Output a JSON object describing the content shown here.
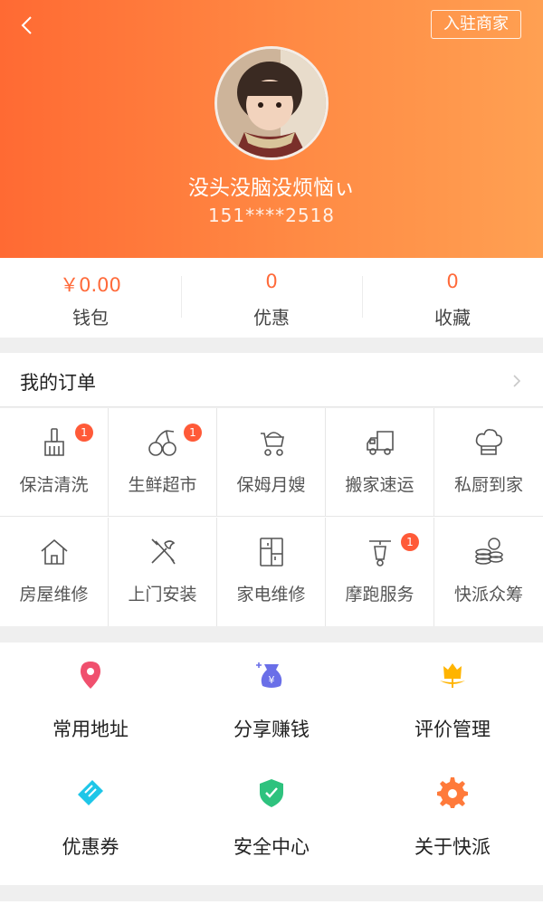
{
  "header": {
    "back_icon": "chevron-left-icon",
    "merchant_button": "入驻商家",
    "username": "没头没脑没烦恼ぃ",
    "phone": "151****2518"
  },
  "stats": [
    {
      "value": "￥0.00",
      "label": "钱包"
    },
    {
      "value": "0",
      "label": "优惠"
    },
    {
      "value": "0",
      "label": "收藏"
    }
  ],
  "orders": {
    "title": "我的订单",
    "services": [
      {
        "label": "保洁清洗",
        "icon": "broom-icon",
        "badge": "1"
      },
      {
        "label": "生鲜超市",
        "icon": "cherries-icon",
        "badge": "1"
      },
      {
        "label": "保姆月嫂",
        "icon": "stroller-icon",
        "badge": ""
      },
      {
        "label": "搬家速运",
        "icon": "truck-icon",
        "badge": ""
      },
      {
        "label": "私厨到家",
        "icon": "chef-hat-icon",
        "badge": ""
      },
      {
        "label": "房屋维修",
        "icon": "house-icon",
        "badge": ""
      },
      {
        "label": "上门安装",
        "icon": "tools-icon",
        "badge": ""
      },
      {
        "label": "家电维修",
        "icon": "fridge-icon",
        "badge": ""
      },
      {
        "label": "摩跑服务",
        "icon": "scooter-icon",
        "badge": "1"
      },
      {
        "label": "快派众筹",
        "icon": "coins-icon",
        "badge": ""
      }
    ]
  },
  "tools": [
    {
      "label": "常用地址",
      "icon": "location-pin-icon",
      "color": "#f0506e"
    },
    {
      "label": "分享赚钱",
      "icon": "money-bag-icon",
      "color": "#6a6fe8"
    },
    {
      "label": "评价管理",
      "icon": "flower-icon",
      "color": "#ffb400"
    },
    {
      "label": "优惠券",
      "icon": "coupon-icon",
      "color": "#1ec6e8"
    },
    {
      "label": "安全中心",
      "icon": "shield-check-icon",
      "color": "#2ec27e"
    },
    {
      "label": "关于快派",
      "icon": "gear-icon",
      "color": "#ff7a3a"
    }
  ],
  "colors": {
    "accent": "#ff6a33",
    "badge": "#ff5a38"
  }
}
